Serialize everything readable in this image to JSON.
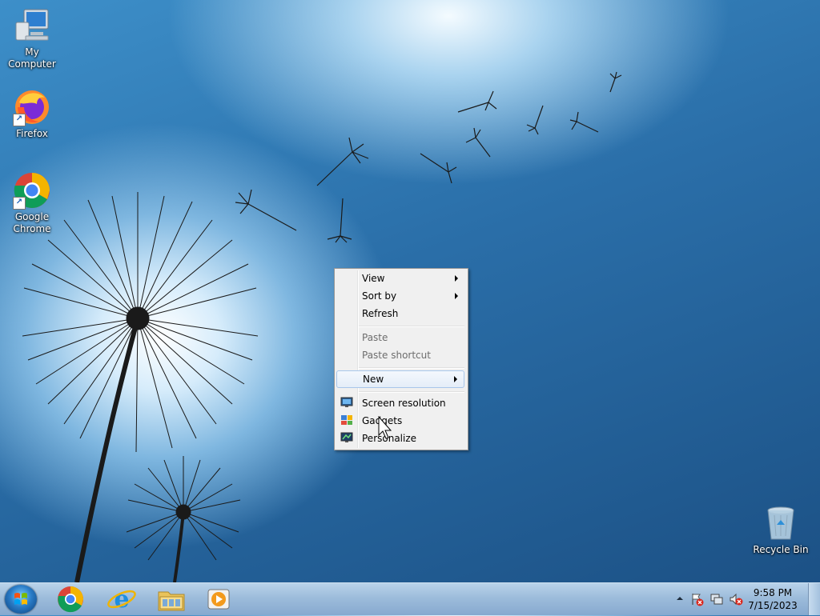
{
  "desktop": {
    "icons": [
      {
        "label": "My Computer",
        "icon": "computer-icon"
      },
      {
        "label": "Firefox",
        "icon": "firefox-icon"
      },
      {
        "label": "Google Chrome",
        "icon": "chrome-icon"
      },
      {
        "label": "Recycle Bin",
        "icon": "recycle-bin-icon"
      }
    ]
  },
  "context_menu": {
    "items": [
      {
        "label": "View",
        "submenu": true,
        "enabled": true
      },
      {
        "label": "Sort by",
        "submenu": true,
        "enabled": true
      },
      {
        "label": "Refresh",
        "submenu": false,
        "enabled": true
      },
      {
        "label": "Paste",
        "submenu": false,
        "enabled": false
      },
      {
        "label": "Paste shortcut",
        "submenu": false,
        "enabled": false
      },
      {
        "label": "New",
        "submenu": true,
        "enabled": true,
        "highlighted": true
      },
      {
        "label": "Screen resolution",
        "icon": "screen-resolution-icon",
        "enabled": true
      },
      {
        "label": "Gadgets",
        "icon": "gadgets-icon",
        "enabled": true
      },
      {
        "label": "Personalize",
        "icon": "personalize-icon",
        "enabled": true
      }
    ]
  },
  "taskbar": {
    "pinned": [
      {
        "name": "chrome",
        "icon": "chrome-icon"
      },
      {
        "name": "internet-explorer",
        "icon": "ie-icon"
      },
      {
        "name": "file-explorer",
        "icon": "folder-icon"
      },
      {
        "name": "media-player",
        "icon": "media-player-icon"
      }
    ],
    "tray_icons": [
      "show-hidden-icons",
      "action-center-flag-icon",
      "network-icon",
      "volume-muted-icon"
    ],
    "clock": {
      "time": "9:58 PM",
      "date": "7/15/2023"
    }
  }
}
